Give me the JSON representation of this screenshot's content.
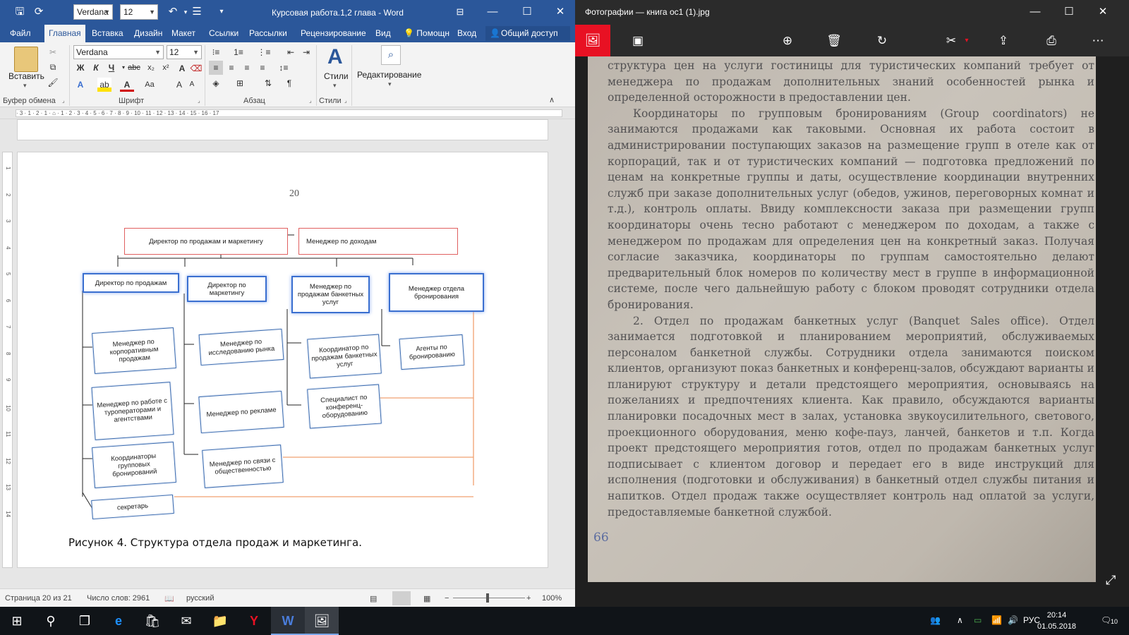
{
  "word": {
    "qat": {
      "font": "Verdana",
      "size": "12",
      "title": "Курсовая работа.1,2 глава - Word"
    },
    "tabs": [
      "Файл",
      "Главная",
      "Вставка",
      "Дизайн",
      "Макет",
      "Ссылки",
      "Рассылки",
      "Рецензирование",
      "Вид"
    ],
    "help": "Помощн",
    "signin": "Вход",
    "share": "Общий доступ",
    "ribbon": {
      "paste": "Вставить",
      "font": "Verdana",
      "size": "12",
      "styles": "Стили",
      "editing": "Редактирование",
      "groups": {
        "clipboard": "Буфер обмена",
        "font": "Шрифт",
        "paragraph": "Абзац",
        "styles": "Стили"
      }
    },
    "ruler_marks": "· 3 · 1 · 2 · 1 · ⌂ · 1 · 2 · 3 · 4 · 5 · 6 · 7 · 8 · 9 · 10 · 11 · 12 · 13 · 14 · 15 · 16 · 17",
    "vruler_marks": [
      "1",
      "2",
      "3",
      "4",
      "5",
      "6",
      "7",
      "8",
      "9",
      "10",
      "11",
      "12",
      "13",
      "14"
    ],
    "page_number": "20",
    "org": {
      "top_left": "Директор по продажам и маркетингу",
      "top_right": "Менеджер по доходам",
      "heads": [
        "Директор по продажам",
        "Директор по маркетингу",
        "Менеджер по продажам банкетных услуг",
        "Менеджер отдела бронирования"
      ],
      "col1": [
        "Менеджер по корпоративным продажам",
        "Менеджер по работе с туроператорами и агентствами",
        "Координаторы групповых бронирований",
        "секретарь"
      ],
      "col2": [
        "Менеджер по исследованию рынка",
        "Менеджер по рекламе",
        "Менеджер по связи с общественностью"
      ],
      "col3": [
        "Координатор по продажам банкетных услуг",
        "Специалист по конференц-оборудованию"
      ],
      "col4": [
        "Агенты по бронированию"
      ]
    },
    "caption": "Рисунок 4. Структура отдела продаж и маркетинга.",
    "status": {
      "page": "Страница 20 из 21",
      "words": "Число слов: 2961",
      "lang": "русский",
      "zoom": "100%"
    }
  },
  "photos": {
    "title": "Фотографии — книга ос1 (1).jpg",
    "text": [
      "структура цен на услуги гостиницы для туристических компаний требует от менеджера по продажам дополнительных знаний особенностей рынка и определенной осторожности в предоставлении цен.",
      "Координаторы по групповым бронированиям (Group coordinators) не занимаются продажами как таковыми. Основная их работа состоит в администрировании поступающих заказов на размещение групп в отеле как от корпораций, так и от туристических компаний — подготовка предложений по ценам на конкретные группы и даты, осуществление координации внутренних служб при заказе дополнительных услуг (обедов, ужинов, переговорных комнат и т.д.), контроль оплаты. Ввиду комплексности заказа при размещении групп координаторы очень тесно работают с менеджером по доходам, а также с менеджером по продажам для определения цен на конкретный заказ. Получая согласие заказчика, координаторы по группам самостоятельно делают предварительный блок номеров по количеству мест в группе в информационной системе, после чего дальнейшую работу с блоком проводят сотрудники отдела бронирования.",
      "2. Отдел по продажам банкетных услуг (Banquet Sales office). Отдел занимается подготовкой и планированием мероприятий, обслуживаемых персоналом банкетной службы. Сотрудники отдела занимаются поиском клиентов, организуют показ банкетных и конференц-залов, обсуждают варианты и планируют структуру и детали предстоящего мероприятия, основываясь на пожеланиях и предпочтениях клиента. Как правило, обсуждаются варианты планировки посадочных мест в залах, установка звукоусилительного, светового, проекционного оборудования, меню кофе-пауз, ланчей, банкетов и т.п. Когда проект предстоящего мероприятия готов, отдел по продажам банкетных услуг подписывает с клиентом договор и передает его в виде инструкций для исполнения (подготовки и обслуживания) в банкетный отдел службы питания и напитков. Отдел продаж также осуществляет контроль над оплатой за услуги, предоставляемые банкетной службой."
    ],
    "page_num": "66"
  },
  "taskbar": {
    "lang": "РУС",
    "time": "20:14",
    "date": "01.05.2018",
    "notif": "10"
  }
}
